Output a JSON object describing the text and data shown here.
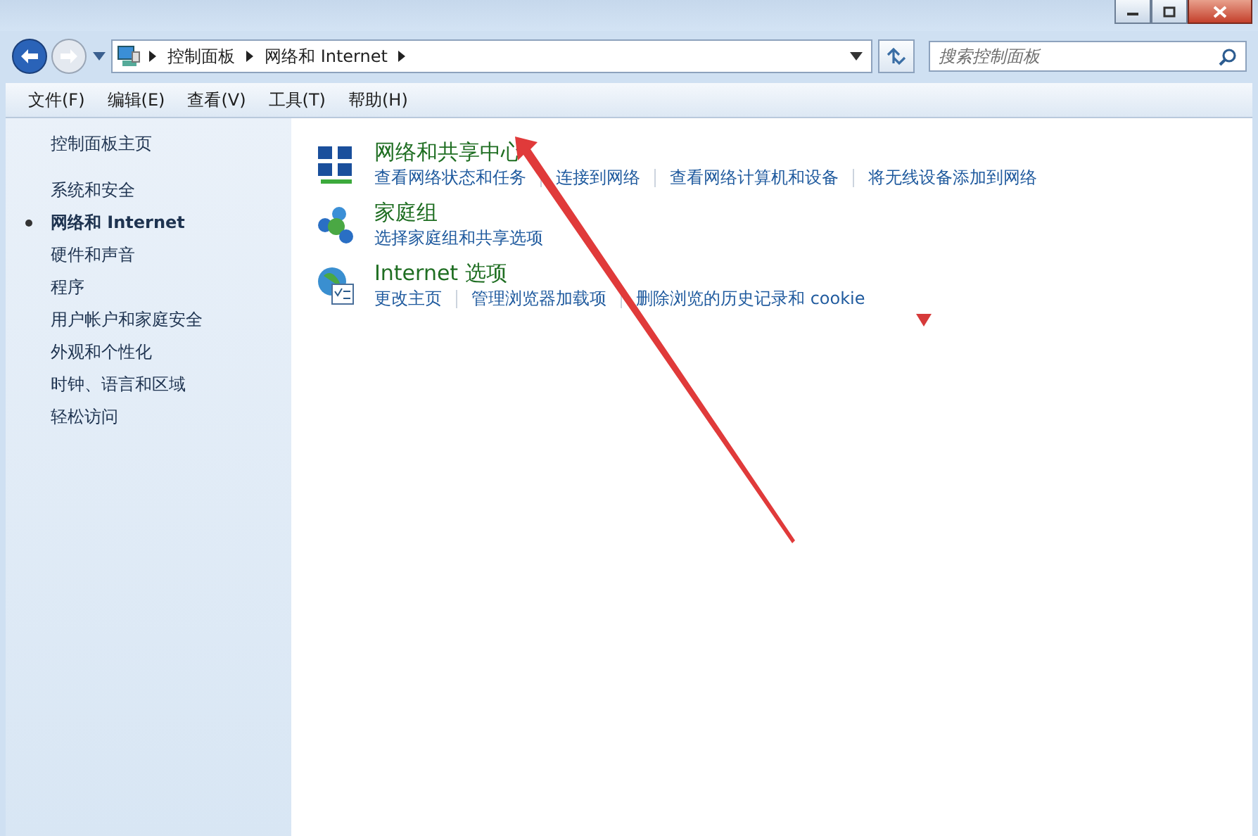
{
  "address_bar": {
    "breadcrumb": [
      "控制面板",
      "网络和 Internet"
    ],
    "search": {
      "placeholder": "搜索控制面板"
    }
  },
  "menu": [
    "文件(F)",
    "编辑(E)",
    "查看(V)",
    "工具(T)",
    "帮助(H)"
  ],
  "sidebar": {
    "home": "控制面板主页",
    "items": [
      {
        "label": "系统和安全",
        "selected": false
      },
      {
        "label": "网络和 Internet",
        "selected": true
      },
      {
        "label": "硬件和声音",
        "selected": false
      },
      {
        "label": "程序",
        "selected": false
      },
      {
        "label": "用户帐户和家庭安全",
        "selected": false
      },
      {
        "label": "外观和个性化",
        "selected": false
      },
      {
        "label": "时钟、语言和区域",
        "selected": false
      },
      {
        "label": "轻松访问",
        "selected": false
      }
    ]
  },
  "categories": [
    {
      "kind": "network",
      "title": "网络和共享中心",
      "links": [
        "查看网络状态和任务",
        "连接到网络",
        "查看网络计算机和设备",
        "将无线设备添加到网络"
      ]
    },
    {
      "kind": "homegroup",
      "title": "家庭组",
      "links": [
        "选择家庭组和共享选项"
      ]
    },
    {
      "kind": "internet",
      "title": "Internet 选项",
      "links": [
        "更改主页",
        "管理浏览器加载项",
        "删除浏览的历史记录和 cookie"
      ]
    }
  ]
}
